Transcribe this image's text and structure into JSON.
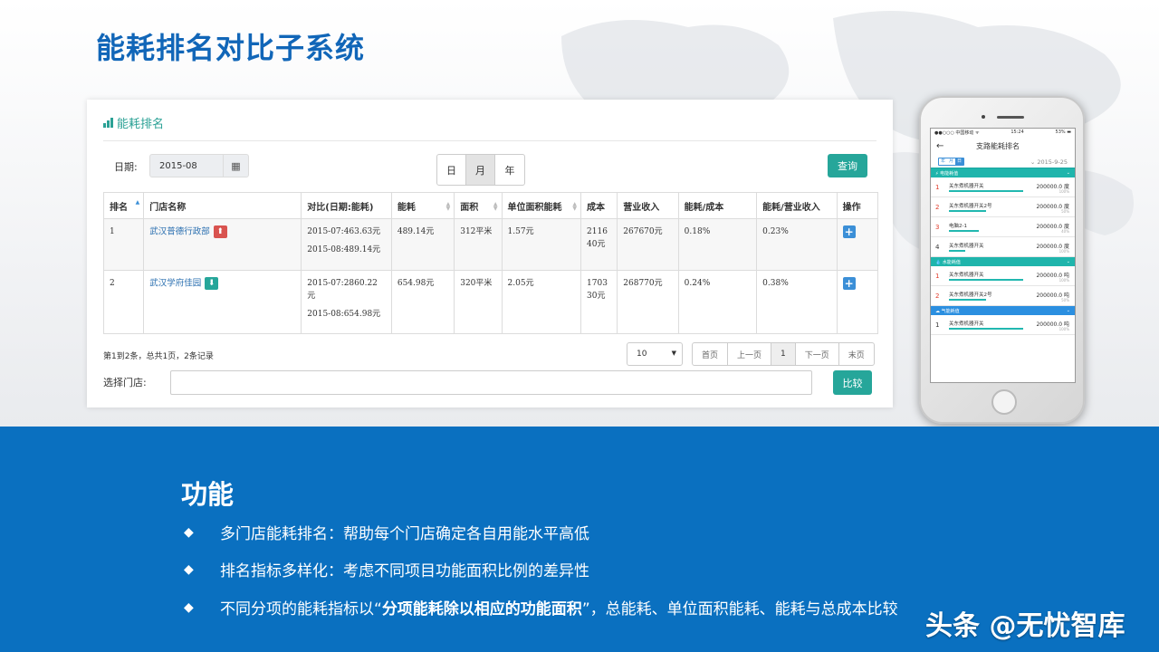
{
  "slide": {
    "title": "能耗排名对比子系统"
  },
  "panel": {
    "title": "能耗排名",
    "date_label": "日期:",
    "date_value": "2015-08",
    "period_options": [
      "日",
      "月",
      "年"
    ],
    "selected_period": "月",
    "query_button": "查询",
    "columns": [
      "排名",
      "门店名称",
      "对比(日期:能耗)",
      "能耗",
      "面积",
      "单位面积能耗",
      "成本",
      "营业收入",
      "能耗/成本",
      "能耗/营业收入",
      "操作"
    ],
    "rows": [
      {
        "rank": "1",
        "store": "武汉普德行政部",
        "trend": "up",
        "compare_1": "2015-07:463.63元",
        "compare_2": "2015-08:489.14元",
        "energy": "489.14元",
        "area": "312平米",
        "unit_energy": "1.57元",
        "cost": "211640元",
        "revenue": "267670元",
        "energy_cost": "0.18%",
        "energy_revenue": "0.23%"
      },
      {
        "rank": "2",
        "store": "武汉学府佳园",
        "trend": "down",
        "compare_1": "2015-07:2860.22元",
        "compare_2": "2015-08:654.98元",
        "energy": "654.98元",
        "area": "320平米",
        "unit_energy": "2.05元",
        "cost": "170330元",
        "revenue": "268770元",
        "energy_cost": "0.24%",
        "energy_revenue": "0.38%"
      }
    ],
    "page_info": "第1到2条，总共1页，2条记录",
    "page_size": "10",
    "pager": [
      "首页",
      "上一页",
      "1",
      "下一页",
      "末页"
    ],
    "current_page": "1",
    "store_select_label": "选择门店:",
    "store_select_value": "",
    "compare_button": "比较",
    "accent_color": "#26a69a"
  },
  "phone": {
    "carrier": "●●○○○ 中国移动 ᯤ",
    "time": "15:24",
    "battery": "53% ▬",
    "back_icon": "←",
    "screen_title": "支路能耗排名",
    "period_options": [
      "年",
      "月",
      "日"
    ],
    "selected_period": "日",
    "date": "2015-9-25",
    "sections": [
      {
        "name": "电能耗值",
        "color": "#1fb5ac",
        "icon": "lightning-icon",
        "items": [
          {
            "rank": "1",
            "name": "关东煮机器开关",
            "value": "200000.0 度",
            "pct": "100%",
            "bar": 1.0,
            "rank_color": "#e03b2a"
          },
          {
            "rank": "2",
            "name": "关东煮机器开关2号",
            "value": "200000.0 度",
            "pct": "50%",
            "bar": 0.5,
            "rank_color": "#e03b2a"
          },
          {
            "rank": "3",
            "name": "电脑2-1",
            "value": "200000.0 度",
            "pct": "40%",
            "bar": 0.4,
            "rank_color": "#e03b2a"
          },
          {
            "rank": "4",
            "name": "关东煮机器开关",
            "value": "200000.0 度",
            "pct": "100%",
            "bar": 0.22,
            "rank_color": "#333333"
          }
        ]
      },
      {
        "name": "水能耗值",
        "color": "#1fb5ac",
        "icon": "water-drop-icon",
        "items": [
          {
            "rank": "1",
            "name": "关东煮机器开关",
            "value": "200000.0 吨",
            "pct": "100%",
            "bar": 1.0,
            "rank_color": "#e03b2a"
          },
          {
            "rank": "2",
            "name": "关东煮机器开关2号",
            "value": "200000.0 吨",
            "pct": "50%",
            "bar": 0.5,
            "rank_color": "#e03b2a"
          }
        ]
      },
      {
        "name": "气能耗值",
        "color": "#2b8fe0",
        "icon": "cloud-icon",
        "items": [
          {
            "rank": "1",
            "name": "关东煮机器开关",
            "value": "200000.0 吨",
            "pct": "100%",
            "bar": 1.0,
            "rank_color": "#333333"
          }
        ]
      }
    ]
  },
  "features": {
    "heading": "功能",
    "bullets": [
      {
        "text": "多门店能耗排名：帮助每个门店确定各自用能水平高低"
      },
      {
        "text": "排名指标多样化：考虑不同项目功能面积比例的差异性"
      },
      {
        "pre": "不同分项的能耗指标以“",
        "bold": "分项能耗除以相应的功能面积",
        "post": "”，总能耗、单位面积能耗、能耗与总成本比较"
      }
    ]
  },
  "watermark": "头条 @无忧智库"
}
